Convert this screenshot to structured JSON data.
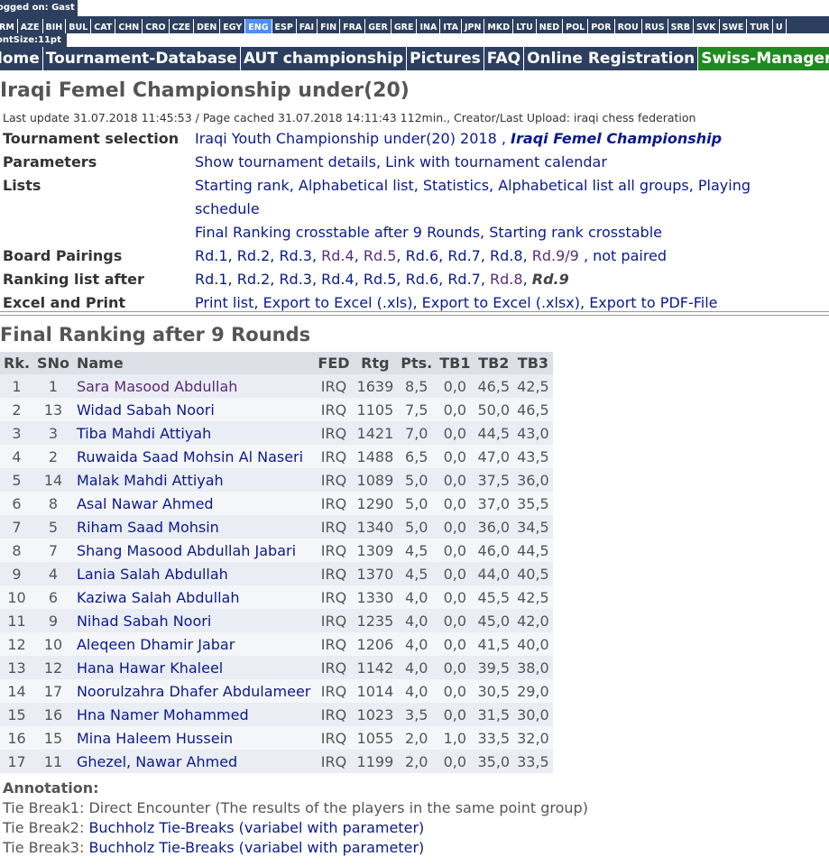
{
  "top": {
    "logged_on": "ogged on: Gast",
    "font_size": "ontSize:11pt",
    "languages": [
      "RM",
      "AZE",
      "BIH",
      "BUL",
      "CAT",
      "CHN",
      "CRO",
      "CZE",
      "DEN",
      "EGY",
      "ENG",
      "ESP",
      "FAI",
      "FIN",
      "FRA",
      "GER",
      "GRE",
      "INA",
      "ITA",
      "JPN",
      "MKD",
      "LTU",
      "NED",
      "POL",
      "POR",
      "ROU",
      "RUS",
      "SRB",
      "SVK",
      "SWE",
      "TUR",
      "U"
    ],
    "active_language": "ENG"
  },
  "nav": {
    "items": [
      "lome",
      "Tournament-Database",
      "AUT championship",
      "Pictures",
      "FAQ",
      "Online Registration",
      "Swiss-Manager"
    ]
  },
  "title": "Iraqi Femel Championship under(20)",
  "last_update": "Last update 31.07.2018 11:45:53 / Page cached 31.07.2018 14:11:43 112min., Creator/Last Upload: iraqi chess federation",
  "info": {
    "tournament_selection_label": "Tournament selection",
    "tournament_link": "Iraqi Youth Championship under(20) 2018",
    "tournament_sep": " , ",
    "tournament_current": "Iraqi Femel Championship",
    "parameters_label": "Parameters",
    "parameters_links": [
      "Show tournament details",
      "Link with tournament calendar"
    ],
    "lists_label": "Lists",
    "lists_links": [
      "Starting rank",
      "Alphabetical list",
      "Statistics",
      "Alphabetical list all groups",
      "Playing schedule"
    ],
    "lists_links2": [
      "Final Ranking crosstable after 9 Rounds",
      "Starting rank crosstable"
    ],
    "board_pairings_label": "Board Pairings",
    "board_pairings": [
      "Rd.1",
      "Rd.2",
      "Rd.3",
      "Rd.4",
      "Rd.5",
      "Rd.6",
      "Rd.7",
      "Rd.8",
      "Rd.9/9"
    ],
    "not_paired": "not paired",
    "ranking_after_label": "Ranking list after",
    "ranking_after": [
      "Rd.1",
      "Rd.2",
      "Rd.3",
      "Rd.4",
      "Rd.5",
      "Rd.6",
      "Rd.7",
      "Rd.8"
    ],
    "ranking_current": "Rd.9",
    "excel_label": "Excel and Print",
    "excel_links": [
      "Print list",
      "Export to Excel (.xls)",
      "Export to Excel (.xlsx)",
      "Export to PDF-File"
    ]
  },
  "ranking": {
    "heading": "Final Ranking after 9 Rounds",
    "columns": [
      "Rk.",
      "SNo",
      "Name",
      "FED",
      "Rtg",
      "Pts.",
      "TB1",
      "TB2",
      "TB3"
    ],
    "rows": [
      [
        "1",
        "1",
        "Sara Masood Abdullah",
        "IRQ",
        "1639",
        "8,5",
        "0,0",
        "46,5",
        "42,5"
      ],
      [
        "2",
        "13",
        "Widad Sabah Noori",
        "IRQ",
        "1105",
        "7,5",
        "0,0",
        "50,0",
        "46,5"
      ],
      [
        "3",
        "3",
        "Tiba Mahdi Attiyah",
        "IRQ",
        "1421",
        "7,0",
        "0,0",
        "44,5",
        "43,0"
      ],
      [
        "4",
        "2",
        "Ruwaida Saad Mohsin Al Naseri",
        "IRQ",
        "1488",
        "6,5",
        "0,0",
        "47,0",
        "43,5"
      ],
      [
        "5",
        "14",
        "Malak Mahdi Attiyah",
        "IRQ",
        "1089",
        "5,0",
        "0,0",
        "37,5",
        "36,0"
      ],
      [
        "6",
        "8",
        "Asal Nawar Ahmed",
        "IRQ",
        "1290",
        "5,0",
        "0,0",
        "37,0",
        "35,5"
      ],
      [
        "7",
        "5",
        "Riham Saad Mohsin",
        "IRQ",
        "1340",
        "5,0",
        "0,0",
        "36,0",
        "34,5"
      ],
      [
        "8",
        "7",
        "Shang Masood Abdullah Jabari",
        "IRQ",
        "1309",
        "4,5",
        "0,0",
        "46,0",
        "44,5"
      ],
      [
        "9",
        "4",
        "Lania Salah Abdullah",
        "IRQ",
        "1370",
        "4,5",
        "0,0",
        "44,0",
        "40,5"
      ],
      [
        "10",
        "6",
        "Kaziwa Salah Abdullah",
        "IRQ",
        "1330",
        "4,0",
        "0,0",
        "45,5",
        "42,5"
      ],
      [
        "11",
        "9",
        "Nihad Sabah Noori",
        "IRQ",
        "1235",
        "4,0",
        "0,0",
        "45,0",
        "42,0"
      ],
      [
        "12",
        "10",
        "Aleqeen Dhamir Jabar",
        "IRQ",
        "1206",
        "4,0",
        "0,0",
        "41,5",
        "40,0"
      ],
      [
        "13",
        "12",
        "Hana Hawar Khaleel",
        "IRQ",
        "1142",
        "4,0",
        "0,0",
        "39,5",
        "38,0"
      ],
      [
        "14",
        "17",
        "Noorulzahra Dhafer Abdulameer",
        "IRQ",
        "1014",
        "4,0",
        "0,0",
        "30,5",
        "29,0"
      ],
      [
        "15",
        "16",
        "Hna Namer Mohammed",
        "IRQ",
        "1023",
        "3,5",
        "0,0",
        "31,5",
        "30,0"
      ],
      [
        "16",
        "15",
        "Mina Haleem Hussein",
        "IRQ",
        "1055",
        "2,0",
        "1,0",
        "33,5",
        "32,0"
      ],
      [
        "17",
        "11",
        "Ghezel, Nawar Ahmed",
        "IRQ",
        "1199",
        "2,0",
        "0,0",
        "35,0",
        "33,5"
      ]
    ]
  },
  "annotation": {
    "title": "Annotation:",
    "tb1_prefix": "Tie Break1:",
    "tb1_text": "Direct Encounter (The results of the players in the same point group)",
    "tb2_prefix": "Tie Break2:",
    "tb2_text": "Buchholz Tie-Breaks (variabel with parameter)",
    "tb3_prefix": "Tie Break3:",
    "tb3_text": "Buchholz Tie-Breaks (variabel with parameter)"
  }
}
